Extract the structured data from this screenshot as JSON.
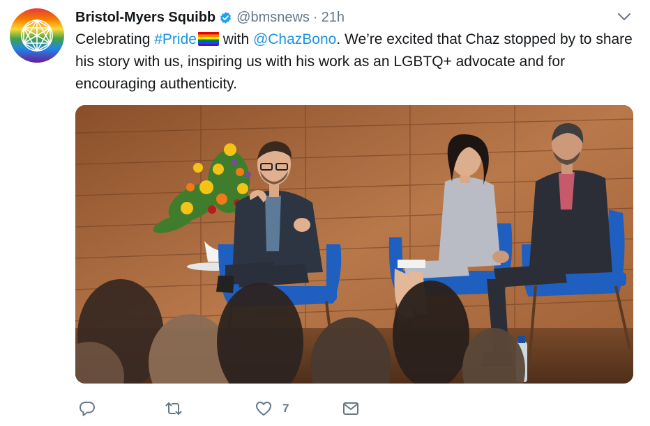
{
  "tweet": {
    "author_name": "Bristol-Myers Squibb",
    "handle": "@bmsnews",
    "separator": "·",
    "time": "21h",
    "text": {
      "part1": "Celebrating ",
      "hashtag": "#Pride",
      "part2": " with ",
      "mention": "@ChazBono",
      "part3": ". We’re excited that Chaz stopped by to share his story with us, inspiring us with his work as an LGBTQ+ advocate and for encouraging authenticity."
    }
  },
  "actions": {
    "like_count": "7"
  },
  "icons": {
    "verified": "verified-badge-icon",
    "caret": "chevron-down-icon",
    "reply": "reply-icon",
    "retweet": "retweet-icon",
    "like": "heart-icon",
    "dm": "envelope-icon"
  },
  "colors": {
    "link": "#1b95e0",
    "secondary_text": "#657786",
    "verified": "#1da1f2"
  }
}
